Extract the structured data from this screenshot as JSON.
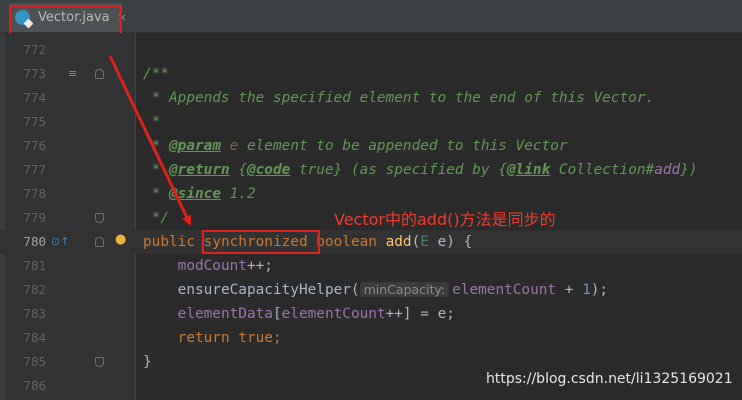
{
  "tab": {
    "label": "Vector.java",
    "close": "×",
    "icon": "java-class-icon"
  },
  "lines": [
    {
      "num": "772"
    },
    {
      "num": "773"
    },
    {
      "num": "774"
    },
    {
      "num": "775"
    },
    {
      "num": "776"
    },
    {
      "num": "777"
    },
    {
      "num": "778"
    },
    {
      "num": "779"
    },
    {
      "num": "780"
    },
    {
      "num": "781"
    },
    {
      "num": "782"
    },
    {
      "num": "783"
    },
    {
      "num": "784"
    },
    {
      "num": "785"
    },
    {
      "num": "786"
    }
  ],
  "code": {
    "l773": "/**",
    "l774": " * Appends the specified element to the end of this Vector.",
    "l775": " *",
    "l776": {
      "pre": " * ",
      "tag": "@param",
      "var": " e",
      "rest": " element to be appended to this Vector"
    },
    "l777": {
      "pre": " * ",
      "tag": "@return",
      "a": " {",
      "code_tag": "@code",
      "b": " true} (as specified by {",
      "link_tag": "@link",
      "c": " Collection#",
      "ref": "add",
      "d": "})"
    },
    "l778": {
      "pre": " * ",
      "tag": "@since",
      "rest": " 1.2"
    },
    "l779": " */",
    "l780": {
      "kw1": "public ",
      "kw2": "synchronized",
      "kw3": " boolean ",
      "fn": "add",
      "p1": "(",
      "type": "E",
      "p2": " e) {"
    },
    "l781": {
      "indent": "    ",
      "field": "modCount",
      "rest": "++;"
    },
    "l782": {
      "indent": "    ",
      "call": "ensureCapacityHelper(",
      "hint": "minCapacity:",
      "field": "elementCount",
      "op": " + ",
      "num": "1",
      "end": ");"
    },
    "l783": {
      "indent": "    ",
      "f1": "elementData",
      "a": "[",
      "f2": "elementCount",
      "b": "++] = e;"
    },
    "l784": {
      "indent": "    ",
      "kw": "return ",
      "kw2": "true",
      "end": ";"
    },
    "l785": "}"
  },
  "annotation": "Vector中的add()方法是同步的",
  "watermark": "https://blog.csdn.net/li1325169021",
  "colors": {
    "annotation_red": "#e0201a",
    "background": "#2b2b2b",
    "gutter": "#313335"
  }
}
